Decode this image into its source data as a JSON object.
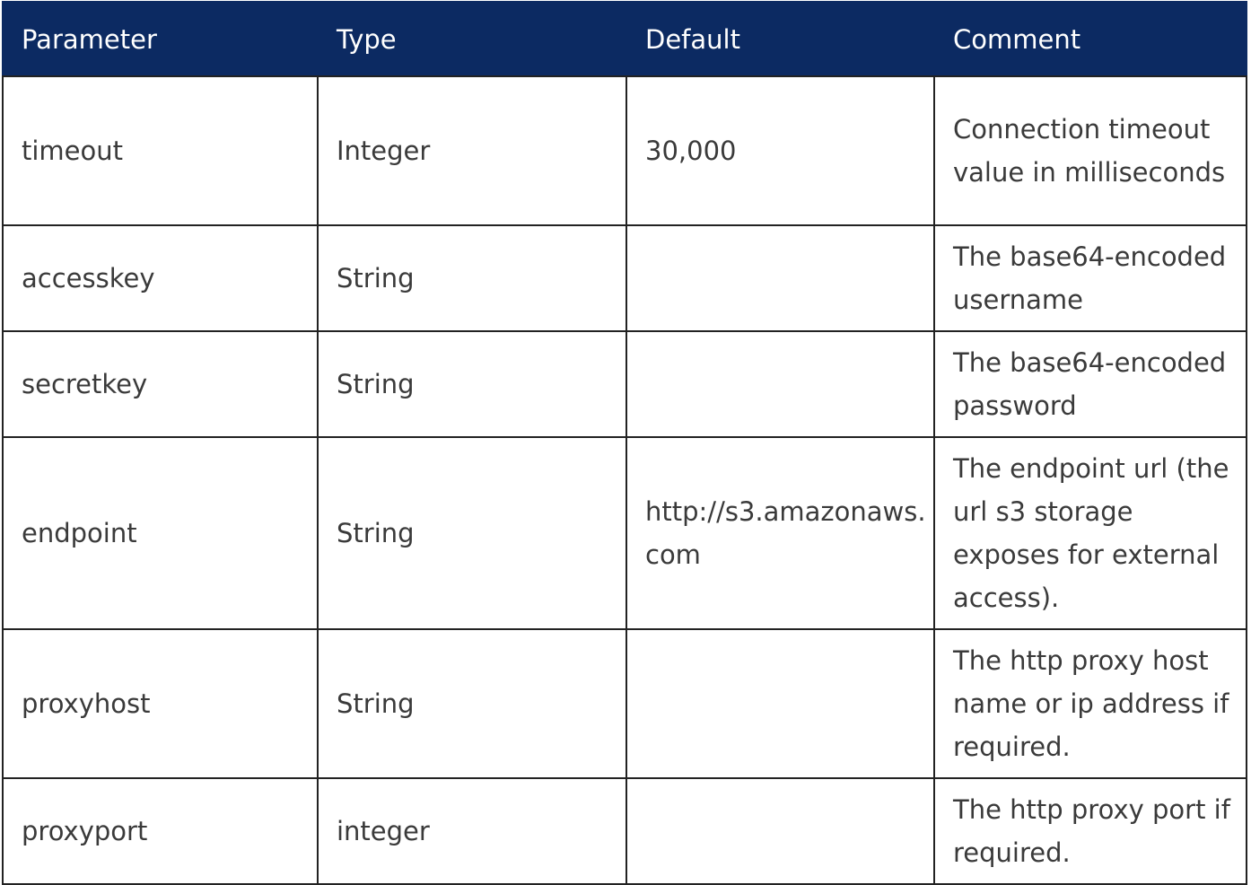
{
  "table": {
    "headers": [
      "Parameter",
      "Type",
      "Default",
      "Comment"
    ],
    "rows": [
      {
        "parameter": "timeout",
        "type": "Integer",
        "default": "30,000",
        "comment": "Connection timeout value in milliseconds"
      },
      {
        "parameter": "accesskey",
        "type": "String",
        "default": "",
        "comment": "The base64-encoded username"
      },
      {
        "parameter": "secretkey",
        "type": "String",
        "default": "",
        "comment": "The base64-encoded password"
      },
      {
        "parameter": "endpoint",
        "type": "String",
        "default": "http://s3.amazonaws.com",
        "comment": "The endpoint url (the url s3 storage exposes for external access)."
      },
      {
        "parameter": "proxyhost",
        "type": "String",
        "default": "",
        "comment": "The http proxy host name or ip address if required."
      },
      {
        "parameter": "proxyport",
        "type": "integer",
        "default": "",
        "comment": "The http proxy port if required."
      }
    ]
  },
  "colors": {
    "header_background": "#0c2a62",
    "header_text": "#ffffff",
    "body_text": "#3a3a3a",
    "border": "#222222"
  }
}
